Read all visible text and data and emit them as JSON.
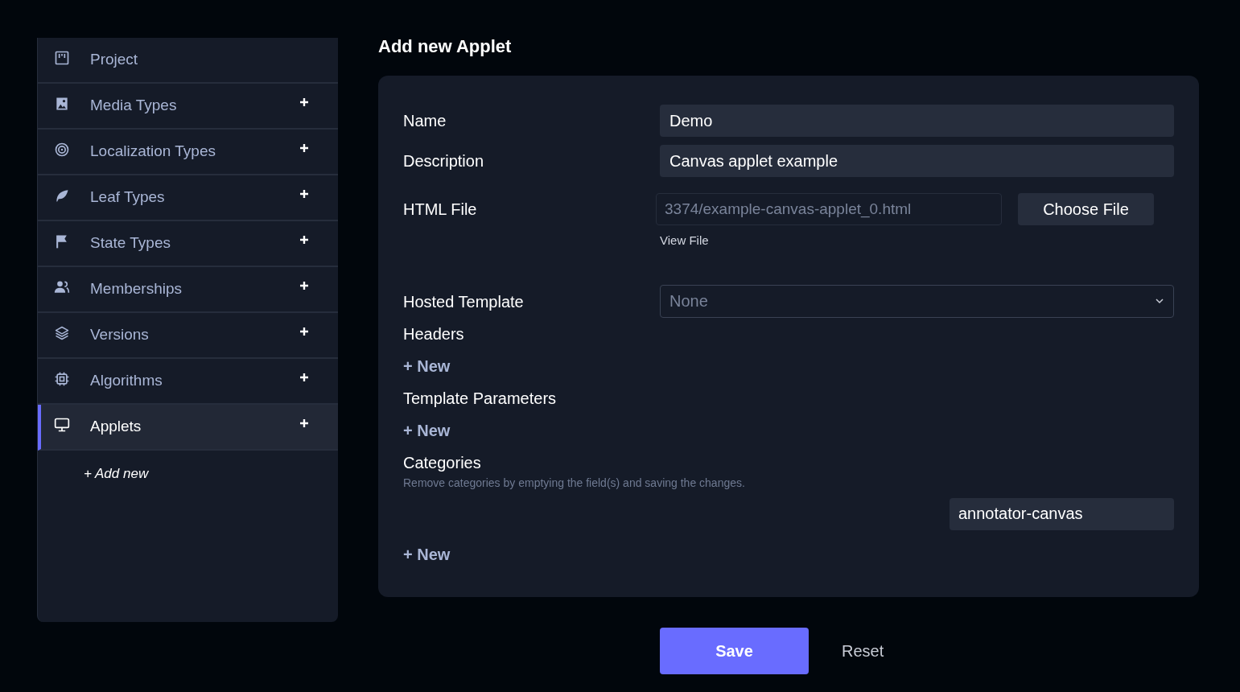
{
  "sidebar": {
    "items": [
      {
        "label": "Project",
        "selected": false,
        "addable": false
      },
      {
        "label": "Media Types",
        "selected": false,
        "addable": true
      },
      {
        "label": "Localization Types",
        "selected": false,
        "addable": true
      },
      {
        "label": "Leaf Types",
        "selected": false,
        "addable": true
      },
      {
        "label": "State Types",
        "selected": false,
        "addable": true
      },
      {
        "label": "Memberships",
        "selected": false,
        "addable": true
      },
      {
        "label": "Versions",
        "selected": false,
        "addable": true
      },
      {
        "label": "Algorithms",
        "selected": false,
        "addable": true
      },
      {
        "label": "Applets",
        "selected": true,
        "addable": true
      }
    ],
    "add_new": "+ Add new"
  },
  "title": "Add new Applet",
  "form": {
    "text_fields": [
      {
        "label": "Name",
        "value": "Demo"
      },
      {
        "label": "Description",
        "value": "Canvas applet example"
      }
    ],
    "html_file": {
      "label": "HTML File",
      "value": "3374/example-canvas-applet_0.html",
      "button": "Choose File",
      "link": "View File"
    },
    "hosted_template": {
      "label": "Hosted Template",
      "value": "None"
    },
    "headers": {
      "label": "Headers",
      "add": "+ New"
    },
    "template_parameters": {
      "label": "Template Parameters",
      "add": "+ New"
    },
    "categories": {
      "label": "Categories",
      "hint": "Remove categories by emptying the field(s) and saving the changes.",
      "items": [
        "annotator-canvas"
      ],
      "add": "+ New"
    }
  },
  "buttons": {
    "save": "Save",
    "reset": "Reset"
  }
}
